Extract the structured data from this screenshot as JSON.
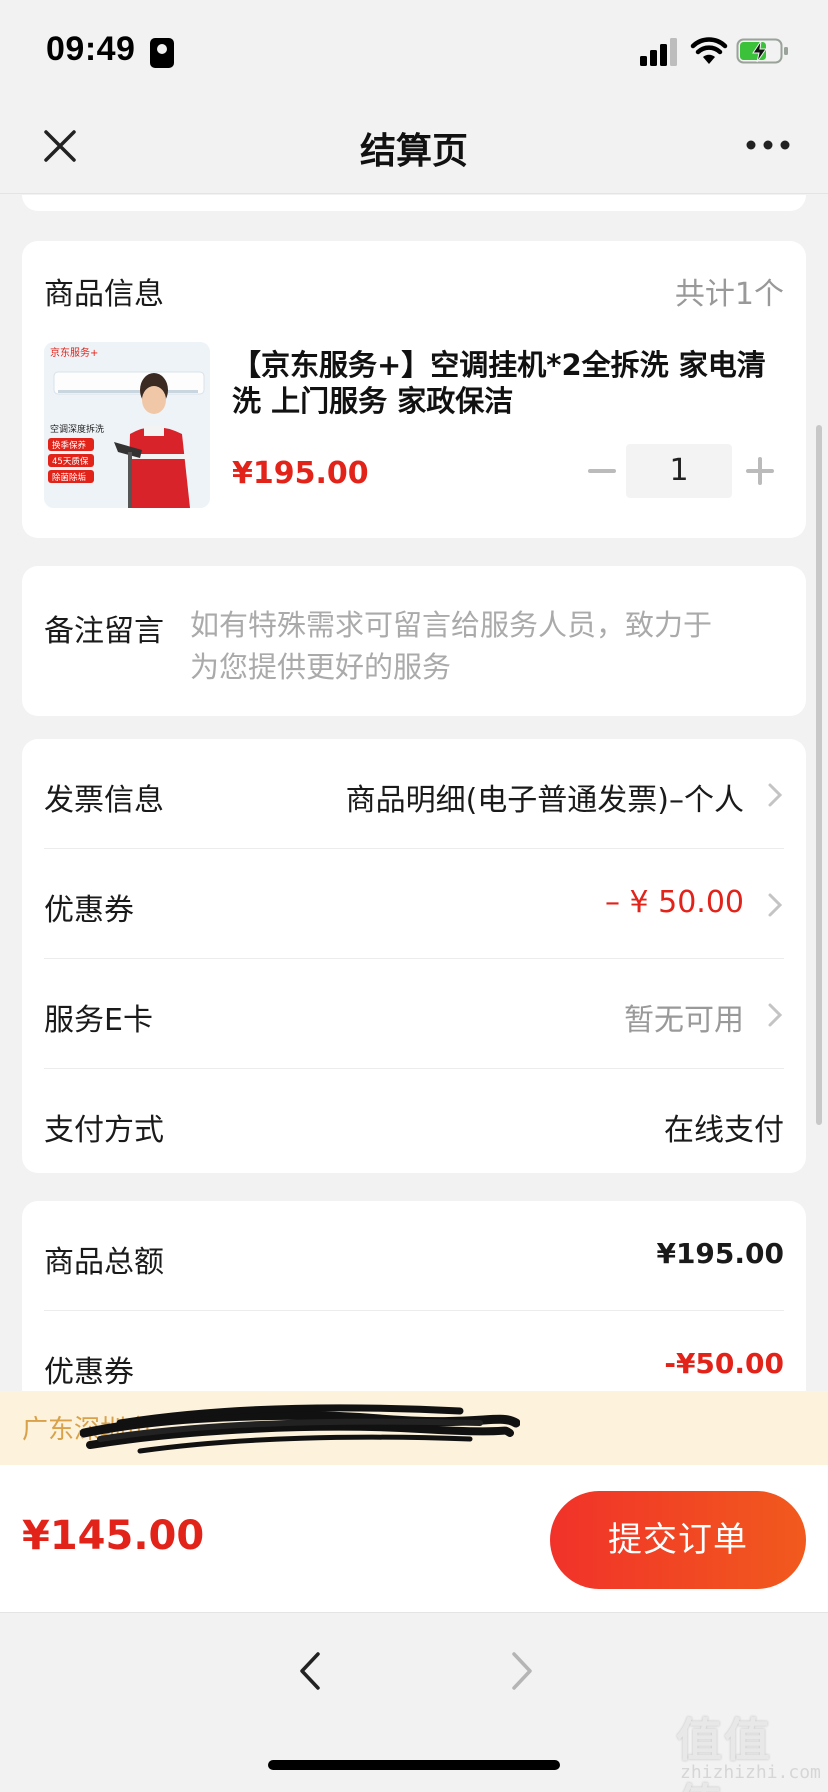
{
  "status_bar": {
    "time": "09:49"
  },
  "nav": {
    "title": "结算页"
  },
  "product_section": {
    "title": "商品信息",
    "count": "共计1个",
    "name": "【京东服务+】空调挂机*2全拆洗 家电清洗 上门服务 家政保洁",
    "price": "¥195.00",
    "quantity": "1",
    "image_texts": {
      "brand": "京东服务+",
      "subtitle": "空调深度拆洗",
      "tags": [
        "换季保养",
        "45天质保",
        "除菌除垢"
      ]
    }
  },
  "note_section": {
    "label": "备注留言",
    "placeholder": "如有特殊需求可留言给服务人员，致力于为您提供更好的服务"
  },
  "options": [
    {
      "label": "发票信息",
      "value": "商品明细(电子普通发票)–个人"
    },
    {
      "label": "优惠券",
      "value": "– ¥ 50.00"
    },
    {
      "label": "服务E卡",
      "value": "暂无可用"
    },
    {
      "label": "支付方式",
      "value": "在线支付"
    }
  ],
  "totals": [
    {
      "label": "商品总额",
      "value": "¥195.00"
    },
    {
      "label": "优惠券",
      "value": "-¥50.00"
    }
  ],
  "address_banner": {
    "text": "广东深圳市"
  },
  "bottom_bar": {
    "total": "¥145.00",
    "submit_label": "提交订单"
  },
  "watermark": {
    "logo": "值值值",
    "text": "zhizhizhi.com"
  },
  "colors": {
    "accent": "#e2231a",
    "button_gradient_end": "#f15a1d",
    "banner_bg": "#fdf2dc",
    "banner_text": "#d9a24a"
  }
}
